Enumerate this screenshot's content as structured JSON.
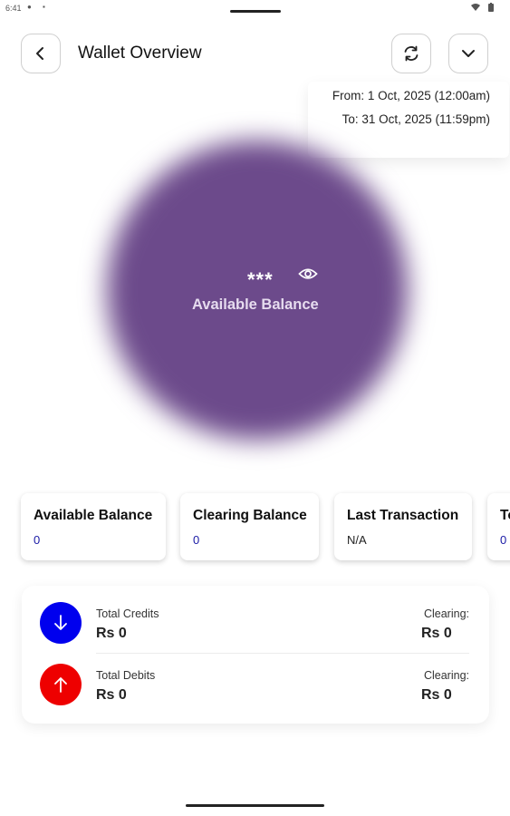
{
  "status_bar": {
    "time": "6:41"
  },
  "header": {
    "title": "Wallet Overview",
    "icons": {
      "back": "chevron-left-icon",
      "refresh": "refresh-icon",
      "expand": "chevron-down-icon"
    }
  },
  "date_range": {
    "from": "From: 1 Oct, 2025 (12:00am)",
    "to": "To: 31 Oct, 2025 (11:59pm)"
  },
  "balance": {
    "masked_value": "***",
    "label": "Available Balance",
    "blob_color": "#6c4a8b",
    "visibility_icon": "eye-icon"
  },
  "cards": [
    {
      "title": "Available Balance",
      "value": "0"
    },
    {
      "title": "Clearing Balance",
      "value": "0"
    },
    {
      "title": "Last Transaction",
      "value": "N/A"
    },
    {
      "title": "To",
      "value": "0"
    }
  ],
  "summary": {
    "credits": {
      "label": "Total Credits",
      "amount": "Rs  0",
      "clearing_label": "Clearing:",
      "clearing_amount": "Rs  0",
      "color": "#0000ee",
      "icon": "arrow-down-icon"
    },
    "debits": {
      "label": "Total Debits",
      "amount": "Rs  0",
      "clearing_label": "Clearing:",
      "clearing_amount": "Rs  0",
      "color": "#ee0000",
      "icon": "arrow-up-icon"
    }
  }
}
